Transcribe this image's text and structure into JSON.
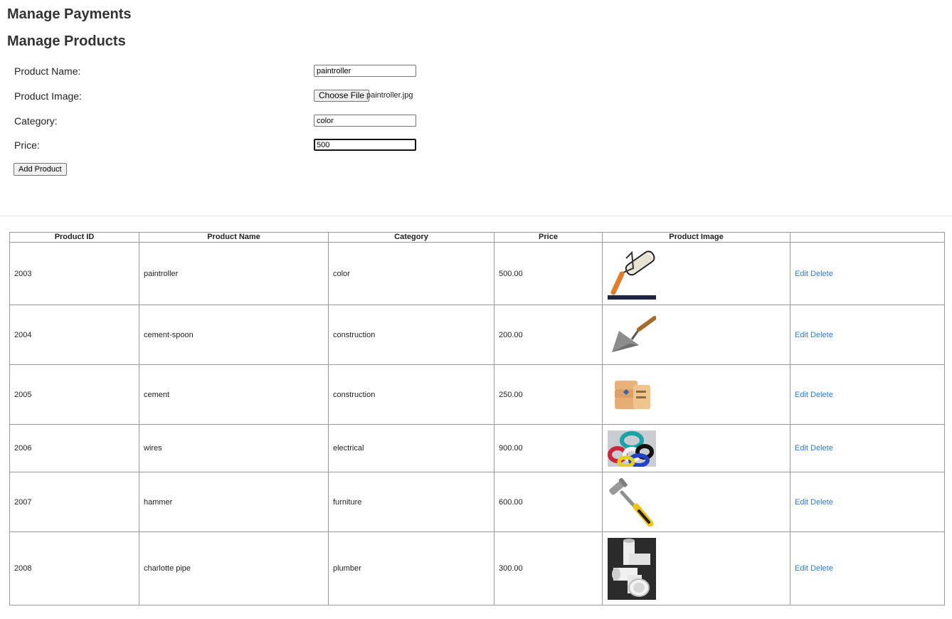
{
  "headings": {
    "payments": "Manage Payments",
    "products": "Manage Products"
  },
  "form": {
    "product_name_label": "Product Name:",
    "product_name_value": "paintroller",
    "product_image_label": "Product Image:",
    "choose_file_label": "Choose File",
    "chosen_file": "paintroller.jpg",
    "category_label": "Category:",
    "category_value": "color",
    "price_label": "Price:",
    "price_value": "500",
    "add_button": "Add Product"
  },
  "table": {
    "headers": [
      "Product ID",
      "Product Name",
      "Category",
      "Price",
      "Product Image",
      ""
    ],
    "edit_label": "Edit",
    "delete_label": "Delete",
    "rows": [
      {
        "id": "2003",
        "name": "paintroller",
        "category": "color",
        "price": "500.00",
        "image": "paint-roller-image"
      },
      {
        "id": "2004",
        "name": "cement-spoon",
        "category": "construction",
        "price": "200.00",
        "image": "trowel-image"
      },
      {
        "id": "2005",
        "name": "cement",
        "category": "construction",
        "price": "250.00",
        "image": "cement-bags-image"
      },
      {
        "id": "2006",
        "name": "wires",
        "category": "electrical",
        "price": "900.00",
        "image": "wire-coils-image"
      },
      {
        "id": "2007",
        "name": "hammer",
        "category": "furniture",
        "price": "600.00",
        "image": "hammer-image"
      },
      {
        "id": "2008",
        "name": "charlotte pipe",
        "category": "plumber",
        "price": "300.00",
        "image": "pvc-pipe-fittings-image"
      }
    ]
  },
  "colors": {
    "link": "#2b7bd6",
    "heading": "#333333",
    "border": "#999999"
  }
}
